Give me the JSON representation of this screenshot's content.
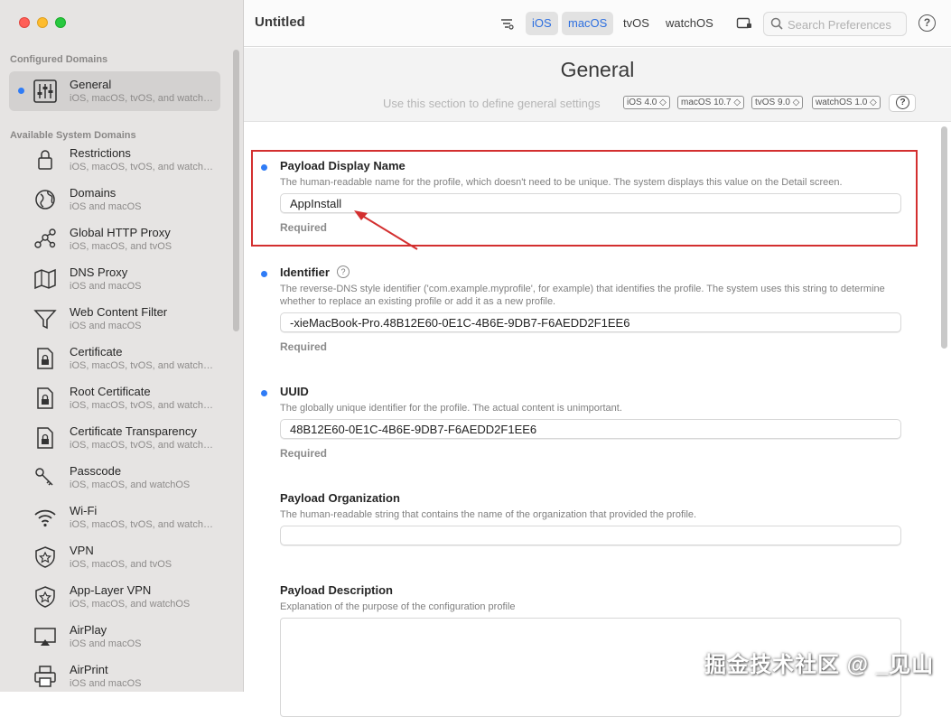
{
  "window": {
    "title": "Untitled"
  },
  "toolbar": {
    "platforms": [
      "iOS",
      "macOS",
      "tvOS",
      "watchOS"
    ],
    "search_placeholder": "Search Preferences",
    "help": "?"
  },
  "sidebar": {
    "configured_label": "Configured Domains",
    "configured_items": [
      {
        "title": "General",
        "subtitle": "iOS, macOS, tvOS, and watchOS",
        "icon": "sliders-icon"
      }
    ],
    "available_label": "Available System Domains",
    "available_items": [
      {
        "title": "Restrictions",
        "subtitle": "iOS, macOS, tvOS, and watchOS",
        "icon": "lock-icon"
      },
      {
        "title": "Domains",
        "subtitle": "iOS and macOS",
        "icon": "globe-icon"
      },
      {
        "title": "Global HTTP Proxy",
        "subtitle": "iOS, macOS, and tvOS",
        "icon": "network-nodes-icon"
      },
      {
        "title": "DNS Proxy",
        "subtitle": "iOS and macOS",
        "icon": "map-icon"
      },
      {
        "title": "Web Content Filter",
        "subtitle": "iOS and macOS",
        "icon": "funnel-icon"
      },
      {
        "title": "Certificate",
        "subtitle": "iOS, macOS, tvOS, and watchOS",
        "icon": "certificate-icon"
      },
      {
        "title": "Root Certificate",
        "subtitle": "iOS, macOS, tvOS, and watchOS",
        "icon": "root-certificate-icon"
      },
      {
        "title": "Certificate Transparency",
        "subtitle": "iOS, macOS, tvOS, and watchOS",
        "icon": "certificate-transparency-icon"
      },
      {
        "title": "Passcode",
        "subtitle": "iOS, macOS, and watchOS",
        "icon": "keys-icon"
      },
      {
        "title": "Wi-Fi",
        "subtitle": "iOS, macOS, tvOS, and watchOS",
        "icon": "wifi-icon"
      },
      {
        "title": "VPN",
        "subtitle": "iOS, macOS, and tvOS",
        "icon": "shield-icon"
      },
      {
        "title": "App-Layer VPN",
        "subtitle": "iOS, macOS, and watchOS",
        "icon": "shield-app-icon"
      },
      {
        "title": "AirPlay",
        "subtitle": "iOS and macOS",
        "icon": "airplay-icon"
      },
      {
        "title": "AirPrint",
        "subtitle": "iOS and macOS",
        "icon": "printer-icon"
      }
    ]
  },
  "header": {
    "title": "General",
    "description": "Use this section to define general settings",
    "versions": [
      "iOS  4.0",
      "macOS  10.7",
      "tvOS  9.0",
      "watchOS  1.0"
    ],
    "help": "?"
  },
  "fields": {
    "display_name": {
      "label": "Payload Display Name",
      "description": "The human-readable name for the profile, which doesn't need to be unique. The system displays this value on the Detail screen.",
      "value": "AppInstall",
      "required": "Required"
    },
    "identifier": {
      "label": "Identifier",
      "description": "The reverse-DNS style identifier ('com.example.myprofile', for example) that identifies the profile. The system uses this string to determine whether to replace an existing profile or add it as a new profile.",
      "value": "-xieMacBook-Pro.48B12E60-0E1C-4B6E-9DB7-F6AEDD2F1EE6",
      "required": "Required",
      "help": "?"
    },
    "uuid": {
      "label": "UUID",
      "description": "The globally unique identifier for the profile. The actual content is unimportant.",
      "value": "48B12E60-0E1C-4B6E-9DB7-F6AEDD2F1EE6",
      "required": "Required"
    },
    "organization": {
      "label": "Payload Organization",
      "description": "The human-readable string that contains the name of the organization that provided the profile.",
      "value": ""
    },
    "description": {
      "label": "Payload Description",
      "description": "Explanation of the purpose of the configuration profile",
      "value": ""
    }
  },
  "watermark": "掘金技术社区 @ _见山",
  "colors": {
    "accent": "#2f7cf6",
    "highlight": "#d32f2f"
  }
}
